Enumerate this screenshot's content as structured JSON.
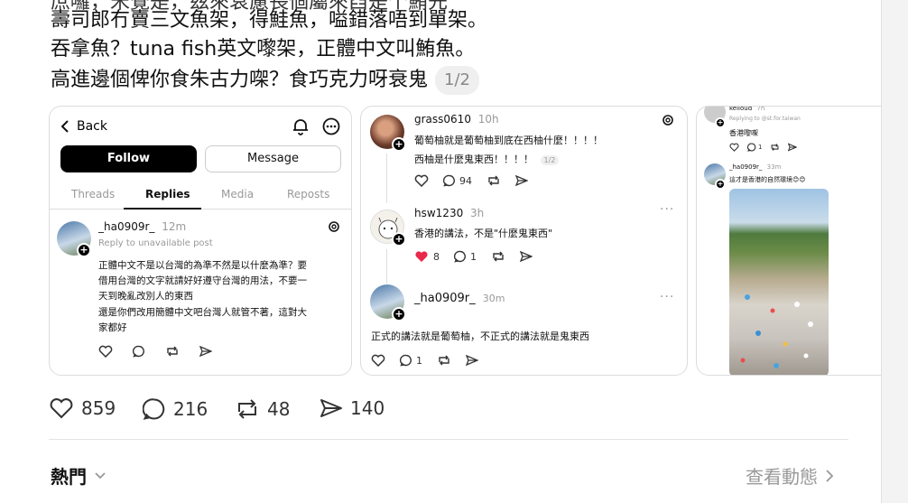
{
  "post": {
    "lines": [
      "庶囉，宋覺是，茲來衰慮長個屬來舀是个鮪先",
      "壽司郎冇賣三文魚架，得鮭魚，嗌錯落唔到單架。",
      "吞拿魚？tuna fish英文嚟架，正體中文叫鮪魚。",
      "高進邊個俾你食朱古力㗎？食巧克力呀衰鬼"
    ],
    "image_counter": "1/2"
  },
  "screenshot1": {
    "back_label": "Back",
    "follow_label": "Follow",
    "message_label": "Message",
    "tabs": [
      "Threads",
      "Replies",
      "Media",
      "Reposts"
    ],
    "username": "_ha0909r_",
    "time": "12m",
    "reply_note": "Reply to unavailable post",
    "body": [
      "正體中文不是以台灣的為準不然是以什麼為準？要",
      "借用台灣的文字就請好好遵守台灣的用法，不要一",
      "天到晚亂改別人的東西",
      "還是你們改用簡體中文吧台灣人就管不著，這對大",
      "家都好"
    ]
  },
  "screenshot2": {
    "post1": {
      "username": "grass0610",
      "time": "10h",
      "line1": "葡萄柚就是葡萄柚到底在西柚什麼！！！！",
      "line2": "西柚是什麼鬼東西！！！！",
      "counter": "1/2",
      "replies": "94"
    },
    "post2": {
      "username": "hsw1230",
      "time": "3h",
      "text": "香港的講法，不是\"什麼鬼東西\"",
      "likes": "8",
      "replies": "1"
    },
    "post3": {
      "username": "_ha0909r_",
      "time": "30m",
      "text": "正式的講法就是葡萄柚，不正式的講法就是鬼東西",
      "replies": "1"
    }
  },
  "screenshot3": {
    "top_user": "kelloud",
    "top_time": "7h",
    "reply_to": "Replying to @st.for.taiwan",
    "top_text": "香港嚟㗎",
    "top_replies": "1",
    "user": "_ha0909r_",
    "time": "33m",
    "text": "這才是香港的自然環境😊😊"
  },
  "actions": {
    "likes": "859",
    "replies": "216",
    "reposts": "48",
    "shares": "140"
  },
  "footer": {
    "hot_label": "熱門",
    "view_activity": "查看動態"
  }
}
